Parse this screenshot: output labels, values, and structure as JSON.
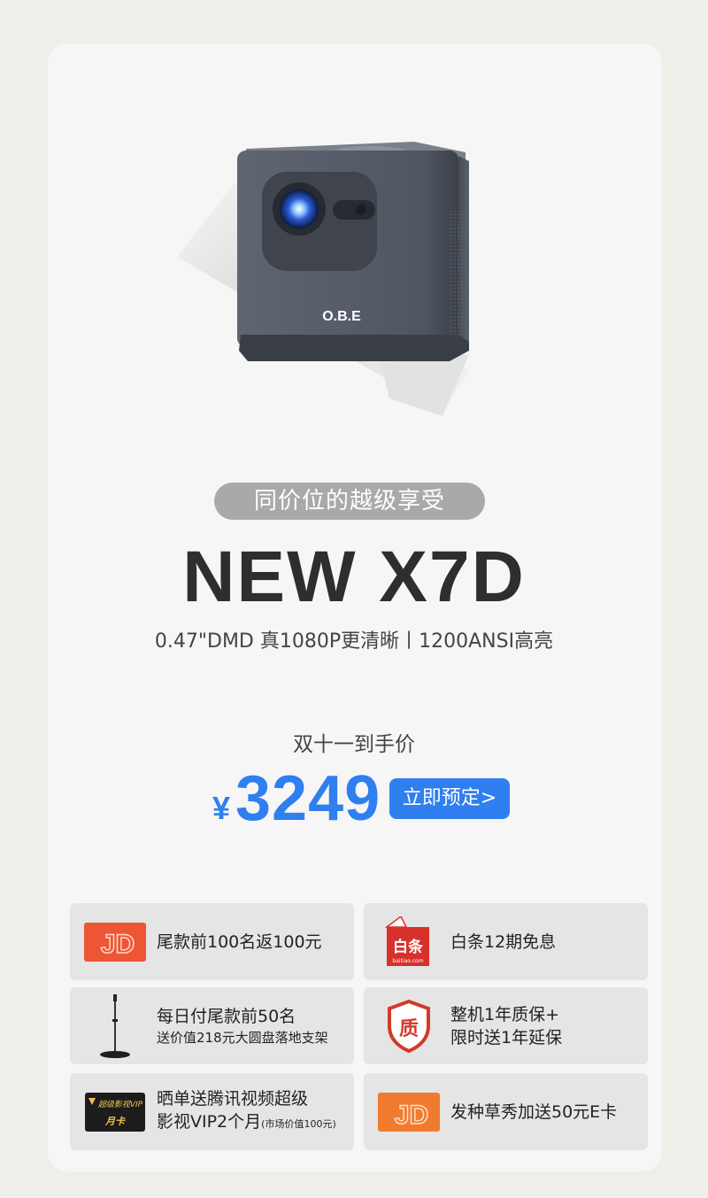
{
  "product": {
    "brand_logo": "O.B.E",
    "image_semantic": "projector-image"
  },
  "hero": {
    "tagline": "同价位的越级享受",
    "model": "NEW X7D",
    "specs": "0.47\"DMD 真1080P更清晰丨1200ANSI高亮"
  },
  "price": {
    "caption": "双十一到手价",
    "currency": "¥",
    "value": "3249",
    "button_label": "立即预定>"
  },
  "benefits": [
    {
      "icon": "jd-card-icon",
      "icon_text": "JD",
      "line1": "尾款前100名返100元"
    },
    {
      "icon": "baitiao-icon",
      "icon_text": "白条",
      "icon_sub": "baitiao.com",
      "line1": "白条12期免息"
    },
    {
      "icon": "floor-stand-icon",
      "line1": "每日付尾款前50名",
      "line2": "送价值218元大圆盘落地支架"
    },
    {
      "icon": "quality-shield-icon",
      "icon_text": "质",
      "line1": "整机1年质保+",
      "line2": "限时送1年延保"
    },
    {
      "icon": "vip-card-icon",
      "icon_text": "超级影视VIP",
      "icon_sub": "月卡",
      "line1": "晒单送腾讯视频超级",
      "line2": "影视VIP2个月",
      "line2_note": "(市场价值100元)"
    },
    {
      "icon": "jd-card-icon",
      "icon_text": "JD",
      "line1": "发种草秀加送50元E卡"
    }
  ],
  "colors": {
    "accent": "#2f7ff0",
    "background": "#efeee8",
    "card": "#f6f6f6",
    "benefit_tile": "#e5e5e5",
    "pill": "#a9a9a9",
    "jd_red": "#e8452a",
    "shield_red": "#d23a2a"
  }
}
